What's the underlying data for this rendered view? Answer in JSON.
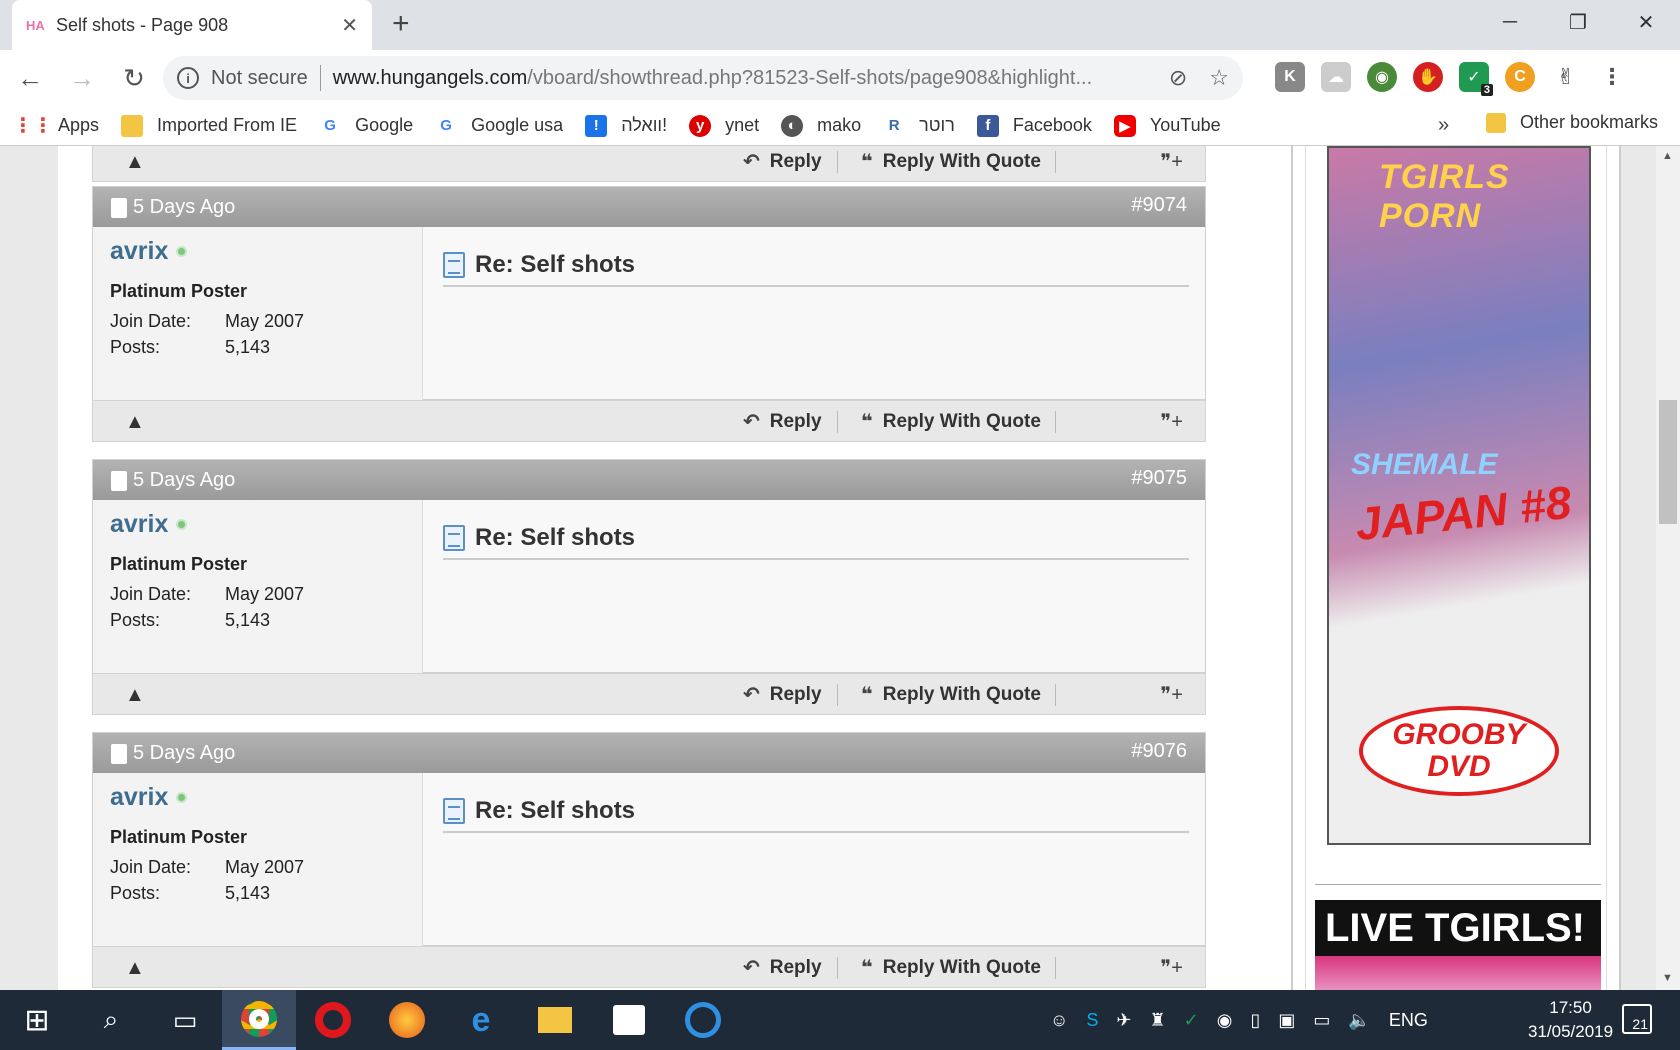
{
  "browser": {
    "tab_title": "Self shots - Page 908",
    "tab_favicon_text": "HA",
    "security_label": "Not secure",
    "url_host": "www.hungangels.com",
    "url_path": "/vboard/showthread.php?81523-Self-shots/page908&highlight...",
    "extension_badge": "3",
    "bookmarks": [
      {
        "label": "Apps",
        "icon": "apps-grid-icon"
      },
      {
        "label": "Imported From IE",
        "icon": "folder-icon"
      },
      {
        "label": "Google",
        "icon": "google-icon"
      },
      {
        "label": "Google usa",
        "icon": "google-icon"
      },
      {
        "label": "וואלה!",
        "icon": "walla-icon"
      },
      {
        "label": "ynet",
        "icon": "ynet-icon"
      },
      {
        "label": "mako",
        "icon": "mako-icon"
      },
      {
        "label": "רוטר",
        "icon": "rotter-icon"
      },
      {
        "label": "Facebook",
        "icon": "facebook-icon"
      },
      {
        "label": "YouTube",
        "icon": "youtube-icon"
      }
    ],
    "bookmarks_overflow": "»",
    "other_bookmarks": "Other bookmarks"
  },
  "actions": {
    "reply": "Reply",
    "reply_with_quote": "Reply With Quote"
  },
  "posts": [
    {
      "date": "5 Days Ago",
      "number": "#9074",
      "user": "avrix",
      "user_title": "Platinum Poster",
      "join_label": "Join Date:",
      "join_value": "May 2007",
      "posts_label": "Posts:",
      "posts_value": "5,143",
      "title": "Re: Self shots"
    },
    {
      "date": "5 Days Ago",
      "number": "#9075",
      "user": "avrix",
      "user_title": "Platinum Poster",
      "join_label": "Join Date:",
      "join_value": "May 2007",
      "posts_label": "Posts:",
      "posts_value": "5,143",
      "title": "Re: Self shots"
    },
    {
      "date": "5 Days Ago",
      "number": "#9076",
      "user": "avrix",
      "user_title": "Platinum Poster",
      "join_label": "Join Date:",
      "join_value": "May 2007",
      "posts_label": "Posts:",
      "posts_value": "5,143",
      "title": "Re: Self shots"
    }
  ],
  "ads": {
    "ad1_title": "TGIRLS PORN",
    "ad1_sub": "SHEMALE",
    "ad1_main": "JAPAN #8",
    "ad1_logo_top": "GROOBY",
    "ad1_logo_bottom": "DVD",
    "ad2_title": "LIVE TGIRLS!"
  },
  "taskbar": {
    "lang": "ENG",
    "time": "17:50",
    "date": "31/05/2019",
    "notifications": "21"
  },
  "colors": {
    "post_header": "#9a9a9a",
    "username": "#3e6d8e",
    "taskbar": "#1f2a38"
  }
}
